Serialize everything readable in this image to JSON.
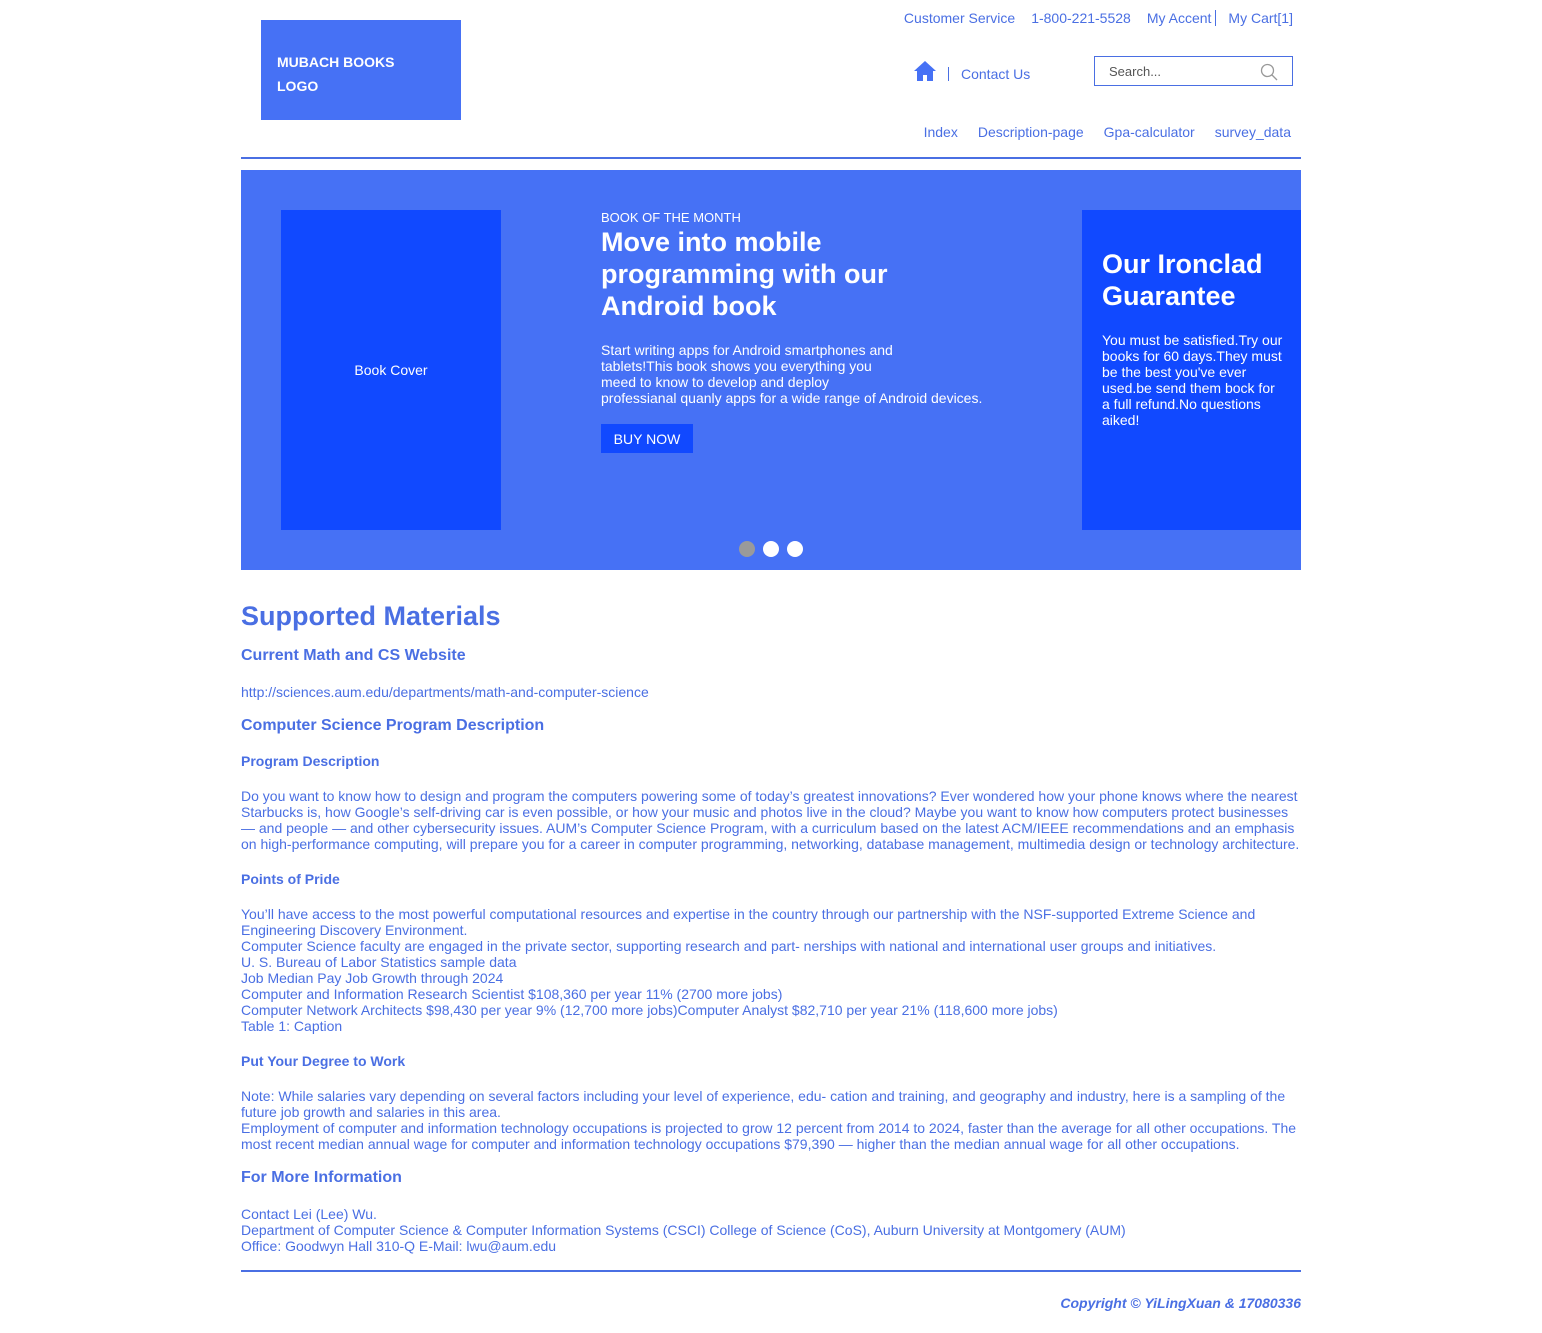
{
  "logo": {
    "text": "MUBACH BOOKS\nLOGO"
  },
  "topbar": {
    "customer_service": "Customer Service",
    "phone": "1-800-221-5528",
    "account": "My Accent",
    "cart": "My Cart[1]"
  },
  "header": {
    "home_icon": "home-icon",
    "contact": "Contact Us",
    "search_placeholder": "Search..."
  },
  "nav": [
    "Index",
    "Description-page",
    "Gpa-calculator",
    "survey_data"
  ],
  "hero": {
    "cover_label": "Book Cover",
    "eyebrow": "BOOK OF THE MONTH",
    "title": "Move into mobile programming with our Android book",
    "text_lines": [
      "Start writing apps for Android smartphones and",
      "tablets!This book shows you everything you",
      "meed to know to develop and deploy",
      "professianal quanly apps for a wide range of Android devices."
    ],
    "button": "BUY NOW",
    "guarantee_title": "Our Ironclad Guarantee",
    "guarantee_text": "You must be satisfied.Try our books for 60 days.They must be the best you've ever used.be send them bock for a full refund.No questions aiked!",
    "carousel_active_index": 0,
    "carousel_count": 3
  },
  "content": {
    "title": "Supported Materials",
    "math_cs_heading": "Current Math and CS Website",
    "math_cs_url": "http://sciences.aum.edu/departments/math-and-computer-science",
    "program_heading": "Computer Science Program Description",
    "program_desc_heading": "Program Description",
    "program_desc_lines": [
      "Do you want to know how to design and program the computers powering some of today’s greatest innovations? Ever wondered how your phone knows where the nearest",
      "Starbucks is, how Google’s self-driving car is even possible, or how your music and photos live in the cloud? Maybe you want to know how computers protect businesses",
      "— and people — and other cybersecurity issues. AUM’s Computer Science Program, with a curriculum based on the latest ACM/IEEE recommendations and an emphasis",
      "on high-performance computing, will prepare you for a career in computer programming, networking, database management, multimedia design or technology architecture."
    ],
    "pride_heading": "Points of Pride",
    "pride_lines": [
      "You’ll have access to the most powerful computational resources and expertise in the country through our partnership with the NSF-supported Extreme Science and",
      "Engineering Discovery Environment.",
      "Computer Science faculty are engaged in the private sector, supporting research and part- nerships with national and international user groups and initiatives.",
      "U. S. Bureau of Labor Statistics sample data",
      "Job Median Pay Job Growth through 2024",
      "Computer and Information Research Scientist $108,360 per year 11% (2700 more jobs)",
      "Computer Network Architects $98,430 per year 9% (12,700 more jobs)Computer Analyst $82,710 per year 21% (118,600 more jobs)",
      "Table 1: Caption"
    ],
    "work_heading": "Put Your Degree to Work",
    "work_lines": [
      "Note: While salaries vary depending on several factors including your level of experience, edu- cation and training, and geography and industry, here is a sampling of the",
      "future job growth and salaries in this area.",
      "Employment of computer and information technology occupations is projected to grow 12 percent from 2014 to 2024, faster than the average for all other occupations. The",
      "most recent median annual wage for computer and information technology occupations $79,390 — higher than the median annual wage for all other occupations."
    ],
    "more_info_heading": "For More Information",
    "more_info_lines": [
      "Contact Lei (Lee) Wu.",
      "Department of Computer Science & Computer Information Systems (CSCI) College of Science (CoS), Auburn University at Montgomery (AUM)",
      "Office: Goodwyn Hall 310-Q E-Mail: lwu@aum.edu"
    ]
  },
  "footer": {
    "copyright": "Copyright © YiLingXuan & 17080336"
  },
  "colors": {
    "brand": "#4671f5",
    "accent_dark": "#1149ff",
    "text": "#4a6fe3"
  }
}
